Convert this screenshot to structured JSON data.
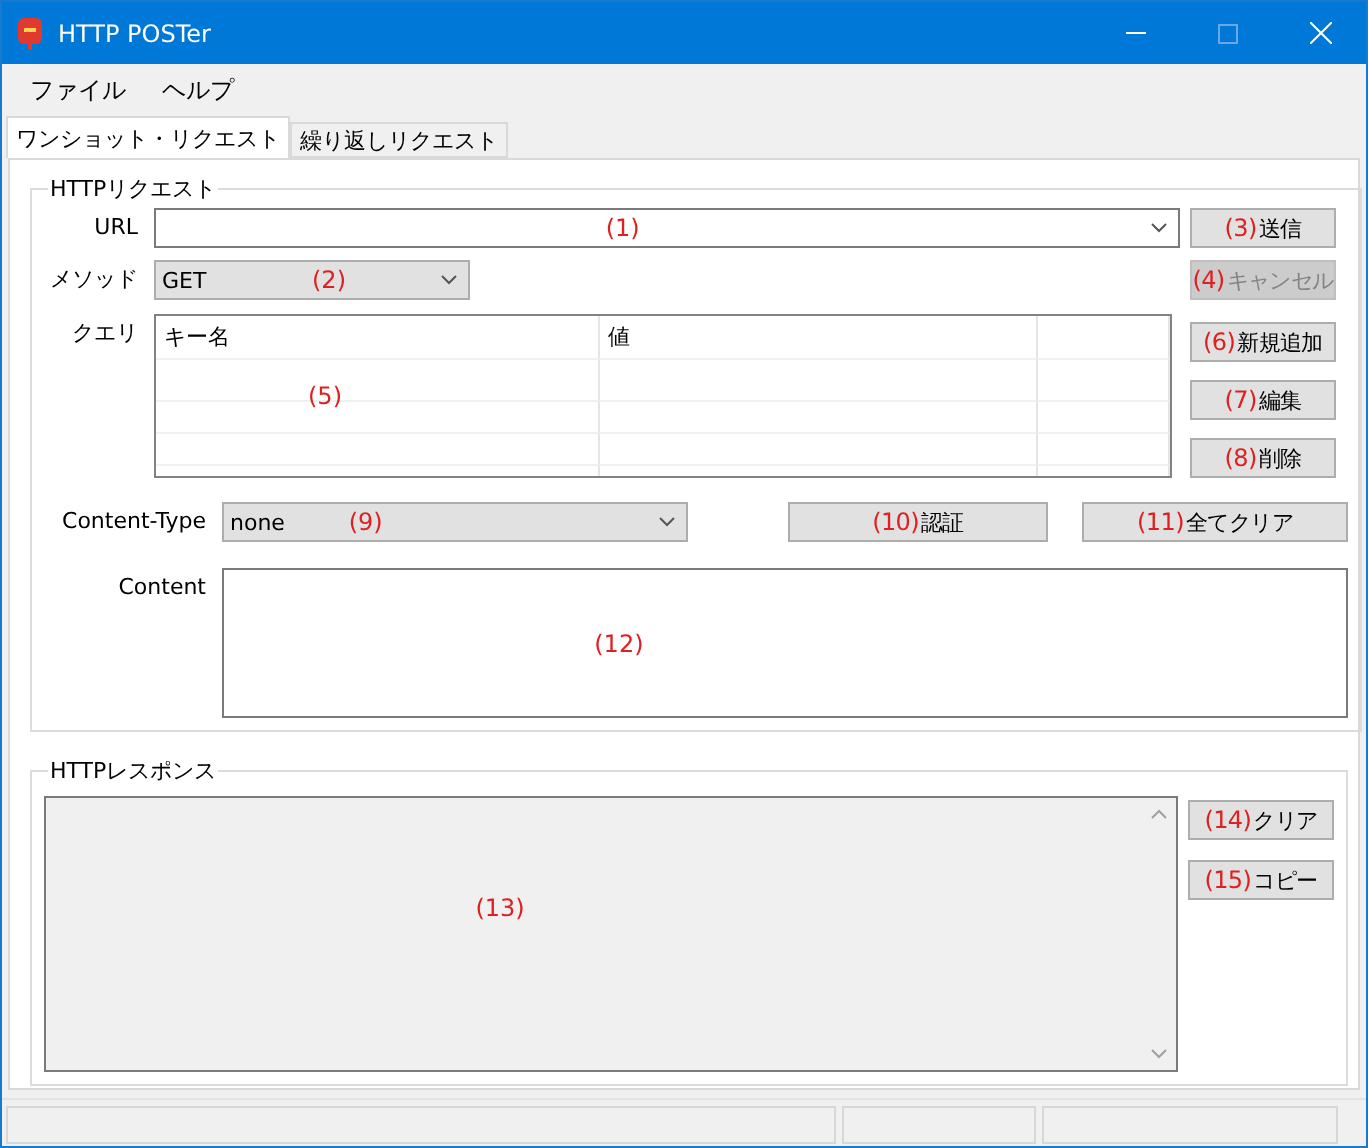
{
  "window": {
    "title": "HTTP POSTer"
  },
  "menu": [
    "ファイル",
    "ヘルプ"
  ],
  "tabs": [
    {
      "label": "ワンショット・リクエスト",
      "selected": true
    },
    {
      "label": "繰り返しリクエスト",
      "selected": false
    }
  ],
  "request": {
    "title": "HTTPリクエスト",
    "url": {
      "label": "URL",
      "callout": "(1)"
    },
    "send_button": {
      "label": "送信",
      "callout": "(3)",
      "disabled": false
    },
    "method": {
      "label": "メソッド",
      "value": "GET",
      "callout": "(2)"
    },
    "cancel_button": {
      "label": "キャンセル",
      "callout": "(4)",
      "disabled": true
    },
    "query": {
      "label": "クエリ",
      "columns": [
        "キー名",
        "値"
      ],
      "callout": "(5)"
    },
    "query_buttons": [
      {
        "label": "新規追加",
        "callout": "(6)",
        "disabled": false
      },
      {
        "label": "編集",
        "callout": "(7)",
        "disabled": false
      },
      {
        "label": "削除",
        "callout": "(8)",
        "disabled": false
      }
    ],
    "content_type": {
      "label": "Content-Type",
      "value": "none",
      "callout": "(9)"
    },
    "auth_button": {
      "label": "認証",
      "callout": "(10)",
      "disabled": false
    },
    "clear_all_button": {
      "label": "全てクリア",
      "callout": "(11)",
      "disabled": false
    },
    "content": {
      "label": "Content",
      "callout": "(12)"
    }
  },
  "response": {
    "title": "HTTPレスポンス",
    "callout": "(13)",
    "buttons": [
      {
        "label": "クリア",
        "callout": "(14)",
        "disabled": false
      },
      {
        "label": "コピー",
        "callout": "(15)",
        "disabled": false
      }
    ]
  }
}
